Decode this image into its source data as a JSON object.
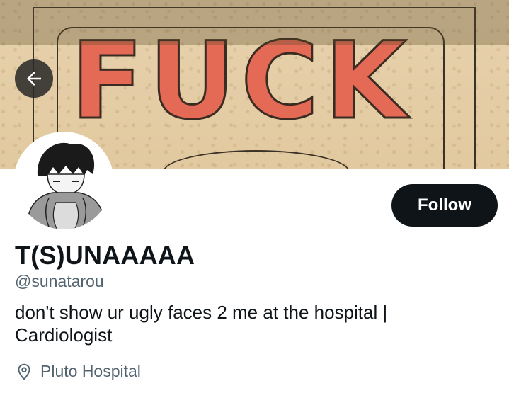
{
  "banner": {
    "word": "FUCK"
  },
  "nav": {
    "back_icon": "arrow-left-icon"
  },
  "profile": {
    "display_name": "T(S)UNAAAAA",
    "handle": "@sunatarou",
    "bio": "don't show ur ugly faces 2 me at the hospital | Cardiologist",
    "location": "Pluto Hospital",
    "location_icon": "location-pin-icon",
    "follow_label": "Follow"
  },
  "colors": {
    "follow_bg": "#0f1419",
    "secondary_text": "#536471",
    "banner_word": "#e46a55"
  }
}
